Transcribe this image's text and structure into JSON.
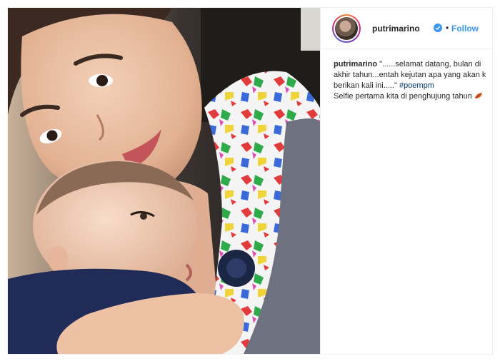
{
  "post": {
    "username": "putrimarino",
    "separator": "•",
    "follow_label": "Follow",
    "caption": {
      "username": "putrimarino",
      "line1": " \"......selamat datang, bulan di",
      "line2": "akhir tahun...entah kejutan apa yang akan k",
      "line3_text": "berikan kali ini.....\" ",
      "hashtag": "#poempm",
      "line4": "Selfie pertama kita di penghujung tahun "
    },
    "icons": {
      "verified": "verified-badge-icon",
      "emoji": "autumn-leaf-emoji-icon"
    },
    "colors": {
      "link": "#3897f0",
      "hashtag": "#003569",
      "verified": "#3897f0"
    }
  }
}
